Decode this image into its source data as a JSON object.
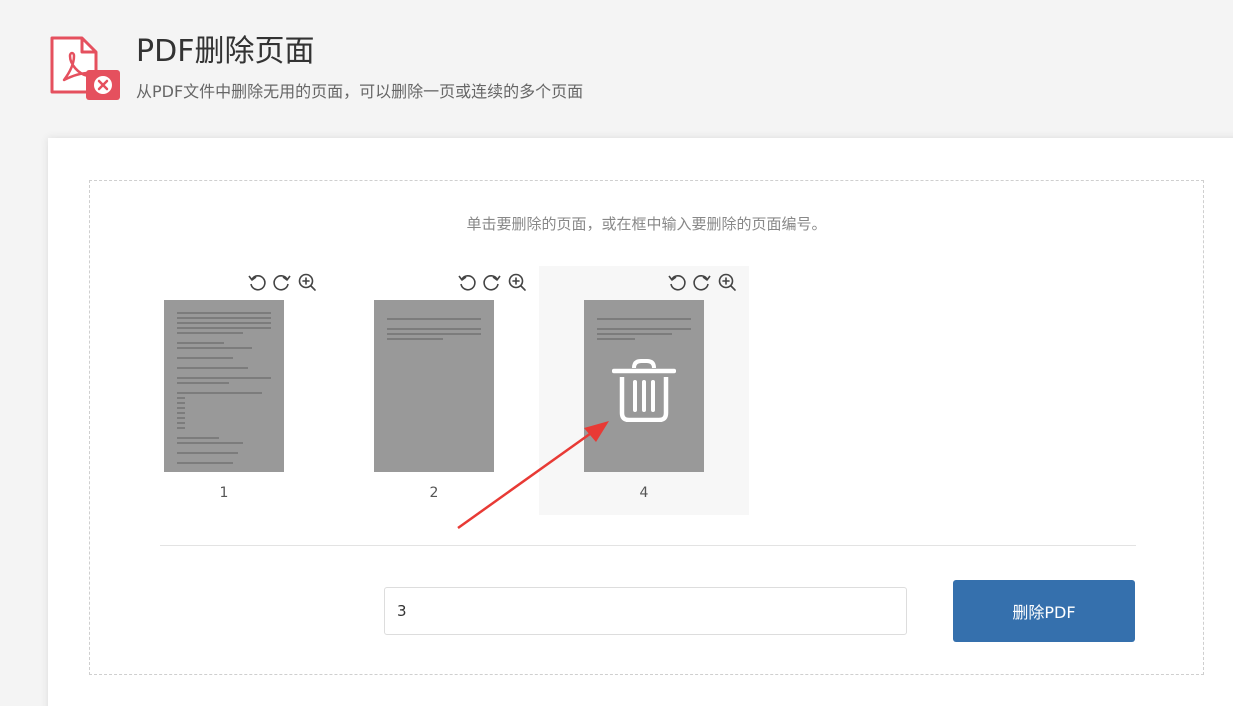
{
  "header": {
    "title": "PDF删除页面",
    "subtitle": "从PDF文件中删除无用的页面，可以删除一页或连续的多个页面",
    "icon": "pdf-delete-icon",
    "accent_color": "#e5505e"
  },
  "main": {
    "instruction": "单击要删除的页面，或在框中输入要删除的页面编号。",
    "pages": [
      {
        "label": "1",
        "selected": false
      },
      {
        "label": "2",
        "selected": false
      },
      {
        "label": "4",
        "selected": true
      }
    ],
    "tools": [
      "rotate-left-icon",
      "rotate-right-icon",
      "zoom-in-icon"
    ],
    "page_input": {
      "value": "3"
    },
    "delete_button": {
      "label": "删除PDF",
      "color": "#3570ad"
    },
    "annotation_color": "#e83a35"
  }
}
